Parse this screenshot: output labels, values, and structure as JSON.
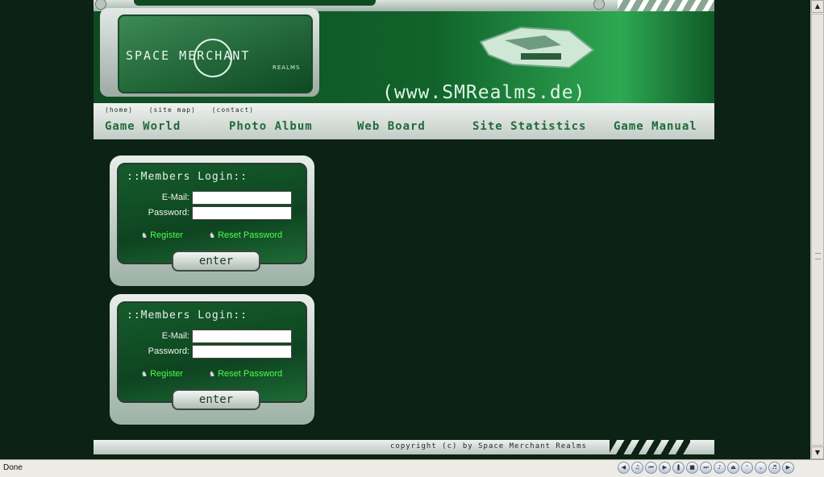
{
  "header": {
    "logo_text": "SPACE MERCHANT",
    "logo_sub": "REALMS",
    "url": "(www.SMRealms.de)",
    "top_links": [
      "(home)",
      "(site map)",
      "(contact)"
    ],
    "nav": [
      "Game World",
      "Photo Album",
      "Web Board",
      "Site Statistics",
      "Game Manual"
    ]
  },
  "panels": [
    {
      "title": "::Members Login::",
      "email_label": "E-Mail:",
      "password_label": "Password:",
      "email_value": "",
      "password_value": "",
      "register_label": "Register",
      "reset_label": "Reset Password",
      "enter_label": "enter"
    },
    {
      "title": "::Members Login::",
      "email_label": "E-Mail:",
      "password_label": "Password:",
      "email_value": "",
      "password_value": "",
      "register_label": "Register",
      "reset_label": "Reset Password",
      "enter_label": "enter"
    }
  ],
  "footer": {
    "text": "copyright (c) by Space Merchant Realms"
  },
  "status": {
    "text": "Done"
  },
  "colors": {
    "background": "#0c2214",
    "accent_green": "#4dff4d",
    "panel_green": "#155c2b"
  },
  "icons": {
    "media_controls": [
      "arrow-left-icon",
      "music-icon",
      "previous-icon",
      "play-icon",
      "pause-icon",
      "stop-icon",
      "next-icon",
      "note-icon",
      "eject-icon",
      "up-icon",
      "down-icon",
      "volume-icon",
      "arrow-right-icon"
    ]
  }
}
